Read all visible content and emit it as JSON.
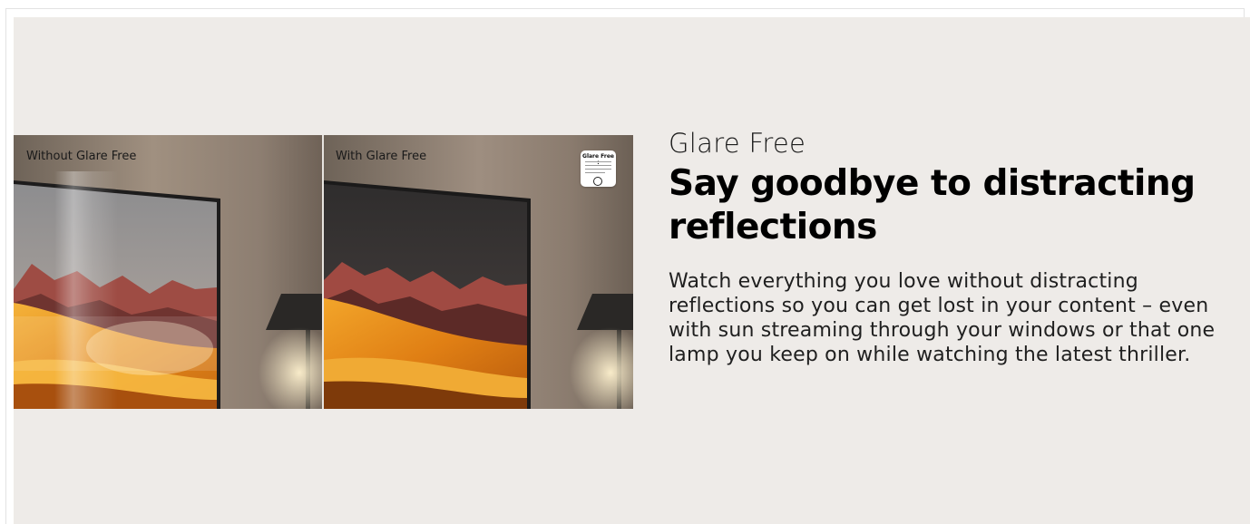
{
  "comparison": {
    "left_label": "Without Glare Free",
    "right_label": "With Glare Free",
    "badge_title": "Glare Free :"
  },
  "feature": {
    "eyebrow": "Glare Free",
    "headline": "Say goodbye to distracting reflections",
    "body": "Watch everything you love without distracting reflections so you can get lost in your content – even with sun streaming through your windows or that one lamp you keep on while watching the latest thriller."
  },
  "colors": {
    "background": "#eeebe8",
    "wall": "#8a7c70",
    "desert_orange": "#e08a1e",
    "mountain_red": "#9c4a43"
  }
}
